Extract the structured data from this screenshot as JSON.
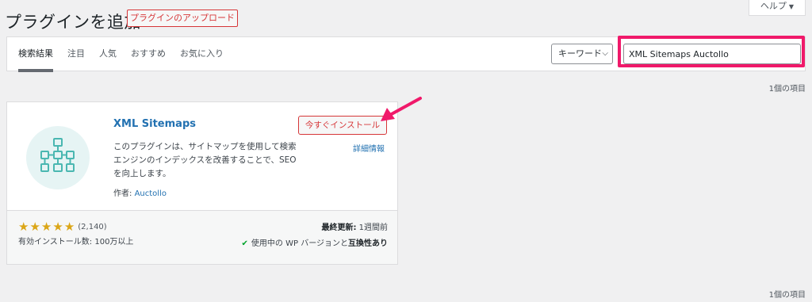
{
  "header": {
    "title": "プラグインを追加",
    "upload_label": "プラグインのアップロード",
    "help_label": "ヘルプ"
  },
  "filter": {
    "tabs": [
      {
        "label": "検索結果",
        "active": true
      },
      {
        "label": "注目",
        "active": false
      },
      {
        "label": "人気",
        "active": false
      },
      {
        "label": "おすすめ",
        "active": false
      },
      {
        "label": "お気に入り",
        "active": false
      }
    ],
    "search_type": "キーワード",
    "search_value": "XML Sitemaps Auctollo"
  },
  "results": {
    "count_text": "1個の項目"
  },
  "plugin": {
    "name": "XML Sitemaps",
    "description": "このプラグインは、サイトマップを使用して検索エンジンのインデックスを改善することで、SEO を向上します。",
    "author_prefix": "作者: ",
    "author": "Auctollo",
    "install_label": "今すぐインストール",
    "details_label": "詳細情報",
    "rating_stars": 5,
    "rating_count": "(2,140)",
    "installs": "有効インストール数: 100万以上",
    "last_updated_label": "最終更新:",
    "last_updated_value": " 1週間前",
    "compat_prefix": "使用中の WP バージョンと",
    "compat_value": "互換性あり",
    "icon": "sitemap-tree-icon"
  },
  "colors": {
    "accent_red": "#d63638",
    "link_blue": "#2271b1",
    "highlight_pink": "#f0196a",
    "star_gold": "#dba617",
    "check_green": "#00a32a",
    "icon_teal": "#4ab7b1"
  }
}
